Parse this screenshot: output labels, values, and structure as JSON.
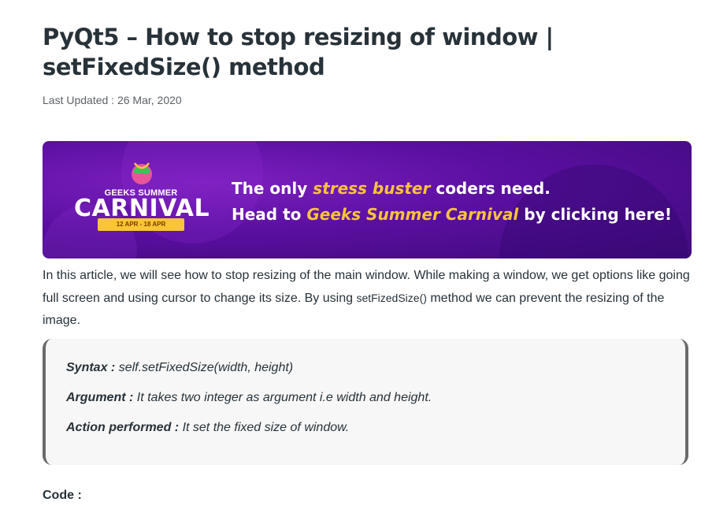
{
  "article": {
    "title": "PyQt5 – How to stop resizing of window | setFixedSize() method",
    "last_updated": "Last Updated : 26 Mar, 2020"
  },
  "banner": {
    "logo_top": "GEEKS SUMMER",
    "logo_main": "CARNIVAL",
    "logo_dates": "12 APR - 18 APR",
    "line1_a": "The only ",
    "line1_highlight": "stress buster",
    "line1_b": " coders need.",
    "line2_a": "Head to ",
    "line2_highlight": "Geeks Summer Carnival",
    "line2_b": " by clicking here!",
    "colors": {
      "background": "#5a0fa0",
      "highlight": "#f9c23c",
      "ribbon": "#f7c43a"
    }
  },
  "intro": {
    "text_before": "In this article, we will see how to stop resizing of the main window. While making a window, we get options like going full screen and using cursor to change its size. By using ",
    "code": "setFizedSize()",
    "text_after": " method we can prevent the resizing of the image."
  },
  "syntax": {
    "syntax_label": "Syntax :",
    "syntax_value": " self.setFixedSize(width, height)",
    "argument_label": "Argument :",
    "argument_value": " It takes two integer as argument i.e width and height.",
    "action_label": "Action performed :",
    "action_value": " It set the fixed size of window."
  },
  "code_label": "Code :"
}
